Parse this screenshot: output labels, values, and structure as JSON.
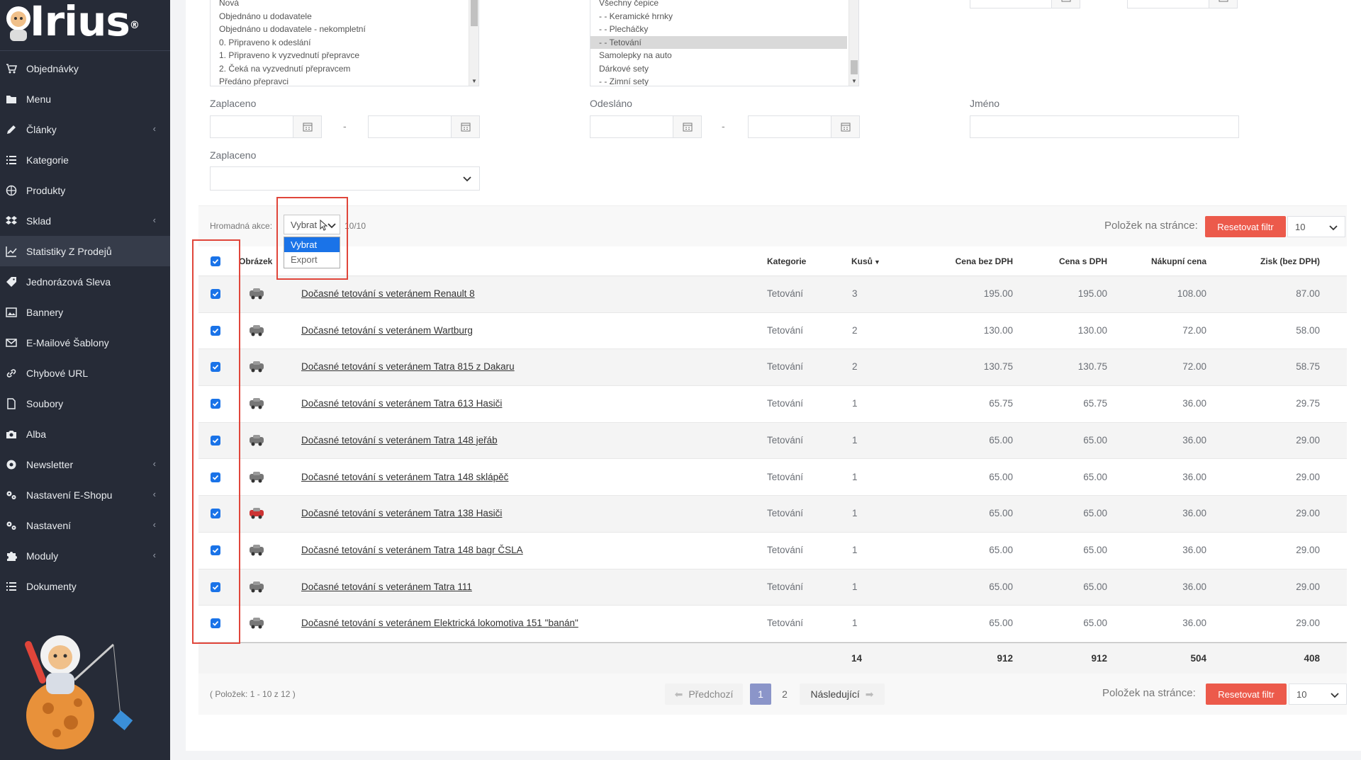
{
  "logo": {
    "text": "Irius",
    "mark": "®"
  },
  "sidebar": {
    "items": [
      {
        "label": "Objednávky",
        "icon": "cart-icon",
        "chevron": false
      },
      {
        "label": "Menu",
        "icon": "folder-icon",
        "chevron": false
      },
      {
        "label": "Články",
        "icon": "pencil-icon",
        "chevron": true
      },
      {
        "label": "Kategorie",
        "icon": "list-icon",
        "chevron": false
      },
      {
        "label": "Produkty",
        "icon": "basketball-icon",
        "chevron": false
      },
      {
        "label": "Sklad",
        "icon": "dropbox-icon",
        "chevron": true
      },
      {
        "label": "Statistiky Z Prodejů",
        "icon": "line-chart-icon",
        "chevron": false,
        "active": true
      },
      {
        "label": "Jednorázová Sleva",
        "icon": "tag-icon",
        "chevron": false
      },
      {
        "label": "Bannery",
        "icon": "image-icon",
        "chevron": false
      },
      {
        "label": "E-Mailové Šablony",
        "icon": "envelope-icon",
        "chevron": false
      },
      {
        "label": "Chybové URL",
        "icon": "link-icon",
        "chevron": false
      },
      {
        "label": "Soubory",
        "icon": "file-icon",
        "chevron": false
      },
      {
        "label": "Alba",
        "icon": "camera-icon",
        "chevron": false
      },
      {
        "label": "Newsletter",
        "icon": "at-icon",
        "chevron": true
      },
      {
        "label": "Nastavení E-Shopu",
        "icon": "cogs-icon",
        "chevron": true
      },
      {
        "label": "Nastavení",
        "icon": "cogs-icon",
        "chevron": true
      },
      {
        "label": "Moduly",
        "icon": "puzzle-icon",
        "chevron": true
      },
      {
        "label": "Dokumenty",
        "icon": "list-icon",
        "chevron": false
      }
    ],
    "chevron_glyph": "‹"
  },
  "filters": {
    "status_options": [
      "Nová",
      "Objednáno u dodavatele",
      "Objednáno u dodavatele - nekompletní",
      "0. Připraveno k odeslání",
      "1. Připraveno k vyzvednutí přepravce",
      "2. Čeká na vyzvednutí přepravcem",
      "Předáno přepravci"
    ],
    "category_options": [
      {
        "label": "Všechny čepice",
        "selected": false
      },
      {
        "label": "- - Keramické hrnky",
        "selected": false
      },
      {
        "label": "- - Plecháčky",
        "selected": false
      },
      {
        "label": "- - Tetování",
        "selected": true
      },
      {
        "label": "Samolepky na auto",
        "selected": false
      },
      {
        "label": "Dárkové sety",
        "selected": false
      },
      {
        "label": "- - Zimní sety",
        "selected": false
      }
    ],
    "paid_label": "Zaplaceno",
    "sent_label": "Odesláno",
    "name_label": "Jméno",
    "paid_select_label": "Zaplaceno",
    "date_dash": "-"
  },
  "toolbar": {
    "mass_action_label": "Hromadná akce:",
    "mass_action_value": "Vybrat",
    "mass_action_options": [
      "Vybrat",
      "Export"
    ],
    "selected_count": "10/10",
    "per_page_label": "Položek na stránce:",
    "reset_label": "Resetovat filtr",
    "per_page_value": "10"
  },
  "table": {
    "columns": [
      "Obrázek",
      "Kategorie",
      "Kusů",
      "Cena bez DPH",
      "Cena s DPH",
      "Nákupní cena",
      "Zisk (bez DPH)"
    ],
    "rows": [
      {
        "name": "Dočasné tetování s veteránem Renault 8",
        "category": "Tetování",
        "qty": "3",
        "price": "195.00",
        "price_vat": "195.00",
        "buy": "108.00",
        "profit": "87.00"
      },
      {
        "name": "Dočasné tetování s veteránem Wartburg",
        "category": "Tetování",
        "qty": "2",
        "price": "130.00",
        "price_vat": "130.00",
        "buy": "72.00",
        "profit": "58.00"
      },
      {
        "name": "Dočasné tetování s veteránem Tatra 815 z Dakaru",
        "category": "Tetování",
        "qty": "2",
        "price": "130.75",
        "price_vat": "130.75",
        "buy": "72.00",
        "profit": "58.75"
      },
      {
        "name": "Dočasné tetování s veteránem Tatra 613 Hasiči",
        "category": "Tetování",
        "qty": "1",
        "price": "65.75",
        "price_vat": "65.75",
        "buy": "36.00",
        "profit": "29.75"
      },
      {
        "name": "Dočasné tetování s veteránem Tatra 148 jeřáb",
        "category": "Tetování",
        "qty": "1",
        "price": "65.00",
        "price_vat": "65.00",
        "buy": "36.00",
        "profit": "29.00"
      },
      {
        "name": "Dočasné tetování s veteránem Tatra 148 sklápěč",
        "category": "Tetování",
        "qty": "1",
        "price": "65.00",
        "price_vat": "65.00",
        "buy": "36.00",
        "profit": "29.00"
      },
      {
        "name": "Dočasné tetování s veteránem Tatra 138 Hasiči",
        "category": "Tetování",
        "qty": "1",
        "price": "65.00",
        "price_vat": "65.00",
        "buy": "36.00",
        "profit": "29.00"
      },
      {
        "name": "Dočasné tetování s veteránem Tatra 148 bagr ČSLA",
        "category": "Tetování",
        "qty": "1",
        "price": "65.00",
        "price_vat": "65.00",
        "buy": "36.00",
        "profit": "29.00"
      },
      {
        "name": "Dočasné tetování s veteránem Tatra 111",
        "category": "Tetování",
        "qty": "1",
        "price": "65.00",
        "price_vat": "65.00",
        "buy": "36.00",
        "profit": "29.00"
      },
      {
        "name": "Dočasné tetování s veteránem Elektrická lokomotiva 151 \"banán\"",
        "category": "Tetování",
        "qty": "1",
        "price": "65.00",
        "price_vat": "65.00",
        "buy": "36.00",
        "profit": "29.00"
      }
    ],
    "totals": {
      "qty": "14",
      "price": "912",
      "price_vat": "912",
      "buy": "504",
      "profit": "408"
    }
  },
  "footer": {
    "range_text": "( Položek: 1 - 10 z 12 )",
    "prev_label": "Předchozí",
    "next_label": "Následující",
    "page_current": "1",
    "page_next": "2",
    "per_page_label": "Položek na stránce:",
    "reset_label": "Resetovat filtr",
    "per_page_value": "10"
  },
  "colors": {
    "sidebar_bg": "#262b37",
    "accent_red": "#ec5a4b",
    "checkbox_blue": "#1a73e8",
    "pager_active": "#8b95c9"
  }
}
